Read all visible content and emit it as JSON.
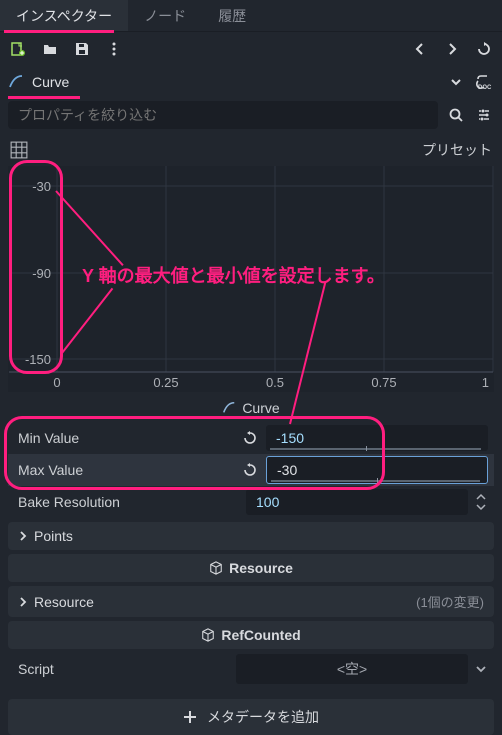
{
  "tabs": {
    "inspector": "インスペクター",
    "node": "ノード",
    "history": "履歴"
  },
  "resource": {
    "type_label": "Curve"
  },
  "filter": {
    "placeholder": "プロパティを絞り込む"
  },
  "graph": {
    "preset_label": "プリセット",
    "y_ticks": [
      "-30",
      "-90",
      "-150"
    ],
    "x_ticks": [
      "0",
      "0.25",
      "0.5",
      "0.75",
      "1"
    ]
  },
  "section": {
    "curve_label": "Curve"
  },
  "props": {
    "min_value": {
      "label": "Min Value",
      "value": "-150"
    },
    "max_value": {
      "label": "Max Value",
      "value": "-30"
    },
    "bake_resolution": {
      "label": "Bake Resolution",
      "value": "100"
    }
  },
  "headers": {
    "points": "Points",
    "resource_center": "Resource",
    "resource_left": "Resource",
    "resource_note": "(1個の変更)",
    "refcounted": "RefCounted"
  },
  "script": {
    "label": "Script",
    "value": "<空>"
  },
  "footer": {
    "add_metadata": "メタデータを追加"
  },
  "annotation": {
    "text": "Y 軸の最大値と最小値を設定します。"
  },
  "chart_data": {
    "type": "line",
    "title": "Curve",
    "xlabel": "",
    "ylabel": "",
    "xlim": [
      0,
      1
    ],
    "ylim": [
      -150,
      -30
    ],
    "x_ticks": [
      0,
      0.25,
      0.5,
      0.75,
      1
    ],
    "y_ticks": [
      -30,
      -90,
      -150
    ],
    "series": []
  }
}
